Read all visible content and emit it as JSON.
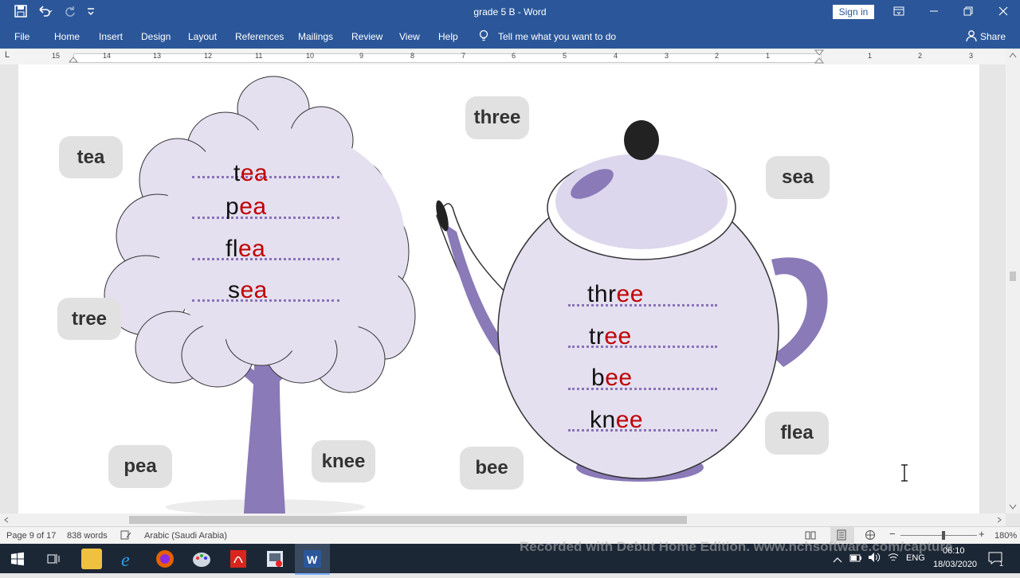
{
  "titlebar": {
    "title": "grade 5 B  -  Word",
    "sign_in": "Sign in"
  },
  "ribbon": {
    "tabs": [
      "File",
      "Home",
      "Insert",
      "Design",
      "Layout",
      "References",
      "Mailings",
      "Review",
      "View",
      "Help"
    ],
    "tell_me": "Tell me what you want to do",
    "share": "Share"
  },
  "ruler": {
    "numbers": [
      "15",
      "14",
      "13",
      "12",
      "11",
      "10",
      "9",
      "8",
      "7",
      "6",
      "5",
      "4",
      "3",
      "2",
      "1",
      "1",
      "2",
      "3"
    ]
  },
  "document": {
    "tiles": {
      "tea": "tea",
      "tree": "tree",
      "pea": "pea",
      "knee": "knee",
      "three": "three",
      "bee": "bee",
      "sea": "sea",
      "flea": "flea"
    },
    "tree_words": [
      {
        "pre": "t",
        "hl": "ea"
      },
      {
        "pre": "p",
        "hl": "ea"
      },
      {
        "pre": "fl",
        "hl": "ea"
      },
      {
        "pre": "s",
        "hl": "ea"
      }
    ],
    "pot_words": [
      {
        "pre": "thr",
        "hl": "ee"
      },
      {
        "pre": "tr",
        "hl": "ee"
      },
      {
        "pre": "b",
        "hl": "ee"
      },
      {
        "pre": "kn",
        "hl": "ee"
      }
    ]
  },
  "status": {
    "page": "Page 9 of 17",
    "words": "838 words",
    "language": "Arabic (Saudi Arabia)",
    "zoom": "180%"
  },
  "taskbar": {
    "watermark": "Recorded with Debut Home Edition. www.nchsoftware.com/capture",
    "lang": "ENG",
    "time": "06:10",
    "date": "18/03/2020",
    "notif_count": "1"
  },
  "colors": {
    "word_blue": "#2b579a",
    "highlight_red": "#c00000",
    "purple": "#8a73b8",
    "lavender": "#e4e0f0"
  }
}
